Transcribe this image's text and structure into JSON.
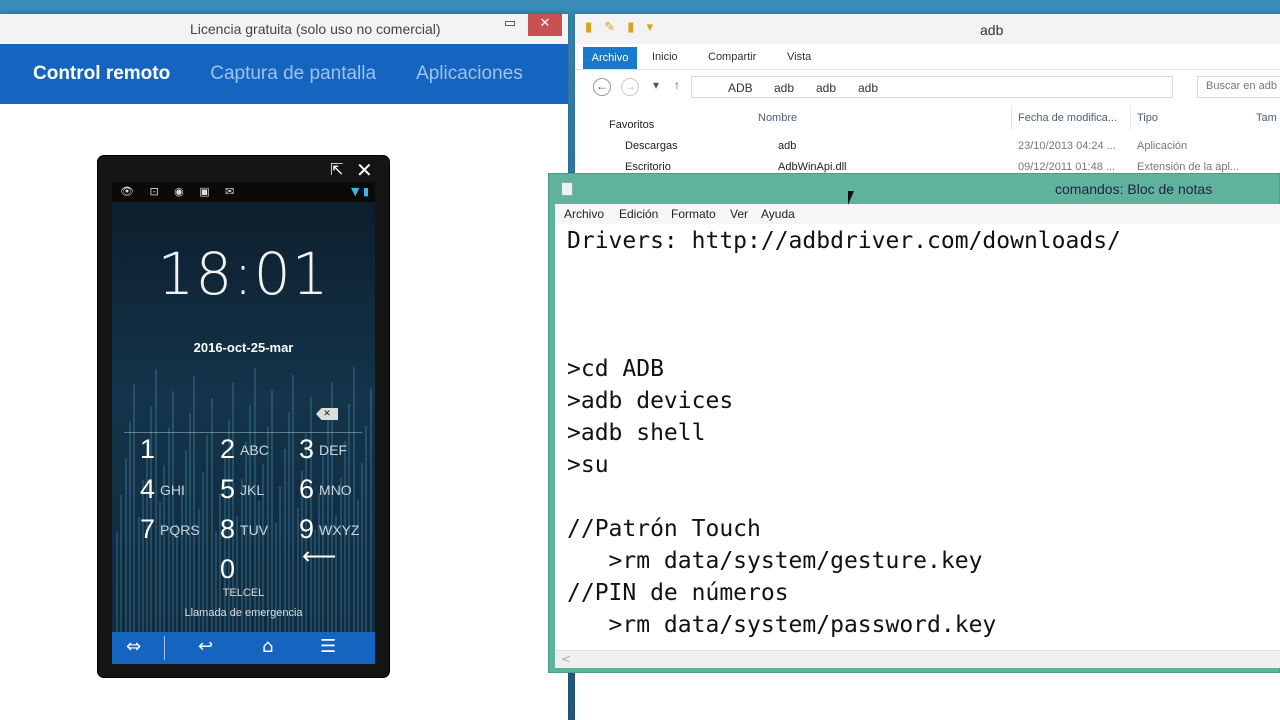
{
  "remote_app": {
    "title": "Licencia gratuita (solo uso no comercial)",
    "minimize_glyph": "▭",
    "close_glyph": "✕",
    "tabs": [
      "Control remoto",
      "Captura de pantalla",
      "Aplicaciones"
    ],
    "phone": {
      "popout_glyph": "⇱",
      "close_glyph": "✕",
      "status_icons": "👁 ⊡ ◉ ▣ ✉",
      "status_right": "▼ ▮",
      "time": "18:01",
      "date": "2016-oct-25-mar",
      "backspace_glyph": "✕",
      "keys": [
        {
          "n": "1",
          "l": ""
        },
        {
          "n": "2",
          "l": "ABC"
        },
        {
          "n": "3",
          "l": "DEF"
        },
        {
          "n": "4",
          "l": "GHI"
        },
        {
          "n": "5",
          "l": "JKL"
        },
        {
          "n": "6",
          "l": "MNO"
        },
        {
          "n": "7",
          "l": "PQRS"
        },
        {
          "n": "8",
          "l": "TUV"
        },
        {
          "n": "9",
          "l": "WXYZ"
        },
        {
          "n": "0",
          "l": ""
        }
      ],
      "enter_glyph": "⟵",
      "carrier": "TELCEL",
      "emergency": "Llamada de emergencia",
      "nav_icons": {
        "app": "⇔",
        "back": "↩",
        "home": "⌂",
        "menu": "☰"
      }
    }
  },
  "explorer": {
    "title": "adb",
    "qat_icons": "▮ ✎ ▮ ▾",
    "ribbon": {
      "file": "Archivo",
      "tabs": [
        "Inicio",
        "Compartir",
        "Vista"
      ]
    },
    "nav": {
      "back": "←",
      "forward": "→",
      "dropdown": "▾",
      "up": "↑"
    },
    "breadcrumb": [
      "ADB",
      "adb",
      "adb",
      "adb"
    ],
    "search_placeholder": "Buscar en adb",
    "nav_pane": [
      "Favoritos",
      "Descargas",
      "Escritorio"
    ],
    "columns": [
      "Nombre",
      "Fecha de modifica...",
      "Tipo",
      "Tam"
    ],
    "rows": [
      {
        "name": "adb",
        "date": "23/10/2013 04:24 ...",
        "type": "Aplicación"
      },
      {
        "name": "AdbWinApi.dll",
        "date": "09/12/2011 01:48 ...",
        "type": "Extensión de la apl..."
      }
    ]
  },
  "notepad": {
    "title": "comandos: Bloc de notas",
    "menu": [
      "Archivo",
      "Edición",
      "Formato",
      "Ver",
      "Ayuda"
    ],
    "lines": [
      "Drivers: http://adbdriver.com/downloads/",
      "",
      "",
      "",
      ">cd ADB",
      ">adb devices",
      ">adb shell",
      ">su",
      "",
      "//Patrón Touch",
      "   >rm data/system/gesture.key",
      "//PIN de números",
      "   >rm data/system/password.key"
    ],
    "scroll_left_glyph": "<"
  }
}
